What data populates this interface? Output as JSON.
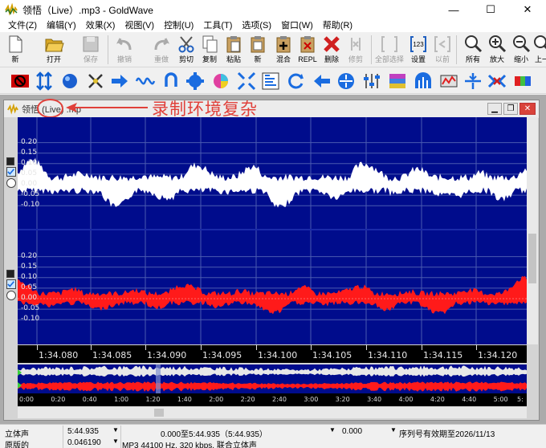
{
  "window": {
    "title": "领悟（Live）.mp3 - GoldWave",
    "controls": [
      "—",
      "☐",
      "✕"
    ]
  },
  "menu": [
    "文件(Z)",
    "编辑(Y)",
    "效果(X)",
    "视图(V)",
    "控制(U)",
    "工具(T)",
    "选项(S)",
    "窗口(W)",
    "帮助(R)"
  ],
  "toolbar": {
    "new": "新",
    "open": "打开",
    "save": "保存",
    "undo": "撤销",
    "redo": "重做",
    "cut": "剪切",
    "copy": "复制",
    "paste": "粘贴",
    "new2": "新",
    "mix": "混合",
    "repl": "REPL",
    "delete": "删除",
    "trim": "修剪",
    "select_all": "全部选择",
    "settings": "设置",
    "previous": "以前",
    "all": "所有",
    "zoom_in": "放大",
    "zoom_out": "缩小",
    "prev_page": "上一"
  },
  "document": {
    "title": "领悟（Live）.mp3",
    "title_visible": "领悟",
    "title_live": "(Live)",
    "title_ext": ".mp"
  },
  "annotation": {
    "text": "录制环境复杂"
  },
  "waveform": {
    "channel1_labels": [
      "0.20",
      "0.15",
      "0.10",
      "0.05",
      "0.00",
      "-0.05",
      "-0.10"
    ],
    "channel2_labels": [
      "0.20",
      "0.15",
      "0.10",
      "0.05",
      "0.00",
      "-0.05",
      "-0.10"
    ],
    "time_labels": [
      "1:34.080",
      "1:34.085",
      "1:34.090",
      "1:34.095",
      "1:34.100",
      "1:34.105",
      "1:34.110",
      "1:34.115",
      "1:34.120"
    ],
    "overview_labels": [
      "0:00",
      "0:20",
      "0:40",
      "1:00",
      "1:20",
      "1:40",
      "2:00",
      "2:20",
      "2:40",
      "3:00",
      "3:20",
      "3:40",
      "4:00",
      "4:20",
      "4:40",
      "5:00",
      "5:"
    ],
    "channel1_color": "#ffffff",
    "channel2_color": "#ff1a1a",
    "background": "#000c8c"
  },
  "status": {
    "channels": "立体声",
    "duration": "5:44.935",
    "selection": "0.000至5:44.935（5:44.935）",
    "cursor": "0.000",
    "license": "序列号有效期至2026/11/13",
    "zoom_label": "原版的",
    "zoom_value": "0.046190",
    "format": "MP3 44100 Hz, 320 kbps, 联合立体声"
  }
}
